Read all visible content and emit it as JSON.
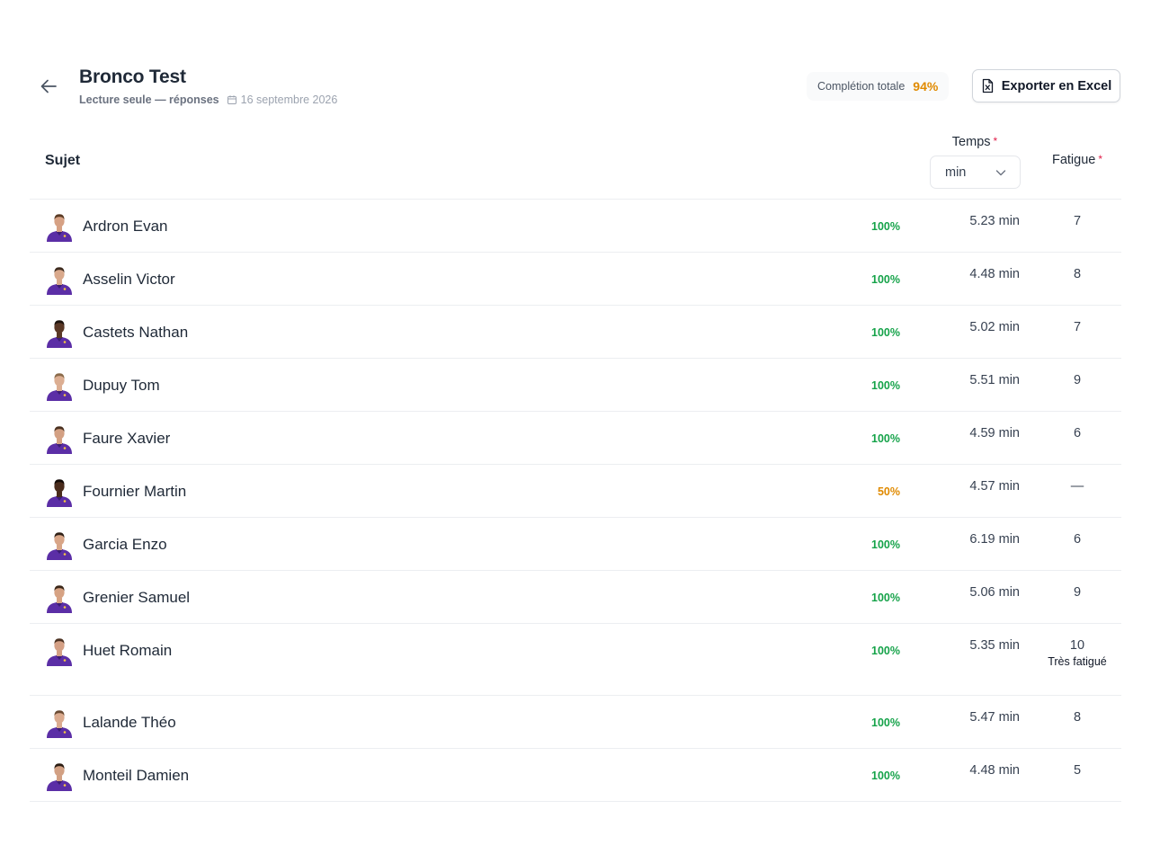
{
  "header": {
    "title": "Bronco Test",
    "mode": "Lecture seule — réponses",
    "date": "16 septembre 2026",
    "completion_label": "Complétion totale",
    "completion_value": "94%",
    "export_label": "Exporter en Excel"
  },
  "table": {
    "col_subject": "Sujet",
    "col_time": "Temps",
    "col_fatigue": "Fatigue",
    "required_mark": "*",
    "unit_selected": "min"
  },
  "colors": {
    "complete": "#16a34a",
    "partial": "#e08a00",
    "jersey": "#5b2ea6",
    "accent": "#e08a00"
  },
  "rows": [
    {
      "name": "Ardron Evan",
      "pct": "100%",
      "time": "5.23 min",
      "fatigue": "7",
      "fatigue_label": "",
      "skin": "#d6a184",
      "hair": "#5a3a24"
    },
    {
      "name": "Asselin Victor",
      "pct": "100%",
      "time": "4.48 min",
      "fatigue": "8",
      "fatigue_label": "",
      "skin": "#d9a98c",
      "hair": "#3d2a1e"
    },
    {
      "name": "Castets Nathan",
      "pct": "100%",
      "time": "5.02 min",
      "fatigue": "7",
      "fatigue_label": "",
      "skin": "#5a3826",
      "hair": "#1c120c"
    },
    {
      "name": "Dupuy Tom",
      "pct": "100%",
      "time": "5.51 min",
      "fatigue": "9",
      "fatigue_label": "",
      "skin": "#dcae92",
      "hair": "#8a6a4a"
    },
    {
      "name": "Faure Xavier",
      "pct": "100%",
      "time": "4.59 min",
      "fatigue": "6",
      "fatigue_label": "",
      "skin": "#d3a083",
      "hair": "#4a3020"
    },
    {
      "name": "Fournier Martin",
      "pct": "50%",
      "time": "4.57 min",
      "fatigue": "—",
      "fatigue_label": "",
      "skin": "#4a2c1c",
      "hair": "#120a06"
    },
    {
      "name": "Garcia Enzo",
      "pct": "100%",
      "time": "6.19 min",
      "fatigue": "6",
      "fatigue_label": "",
      "skin": "#d8a587",
      "hair": "#2f2016"
    },
    {
      "name": "Grenier Samuel",
      "pct": "100%",
      "time": "5.06 min",
      "fatigue": "9",
      "fatigue_label": "",
      "skin": "#d6a283",
      "hair": "#3a2618"
    },
    {
      "name": "Huet Romain",
      "pct": "100%",
      "time": "5.35 min",
      "fatigue": "10",
      "fatigue_label": "Très fatigué",
      "skin": "#d4a085",
      "hair": "#4c3222"
    },
    {
      "name": "Lalande Théo",
      "pct": "100%",
      "time": "5.47 min",
      "fatigue": "8",
      "fatigue_label": "",
      "skin": "#dbab8f",
      "hair": "#6a4a32"
    },
    {
      "name": "Monteil Damien",
      "pct": "100%",
      "time": "4.48 min",
      "fatigue": "5",
      "fatigue_label": "",
      "skin": "#d2a083",
      "hair": "#2a1c12"
    }
  ]
}
